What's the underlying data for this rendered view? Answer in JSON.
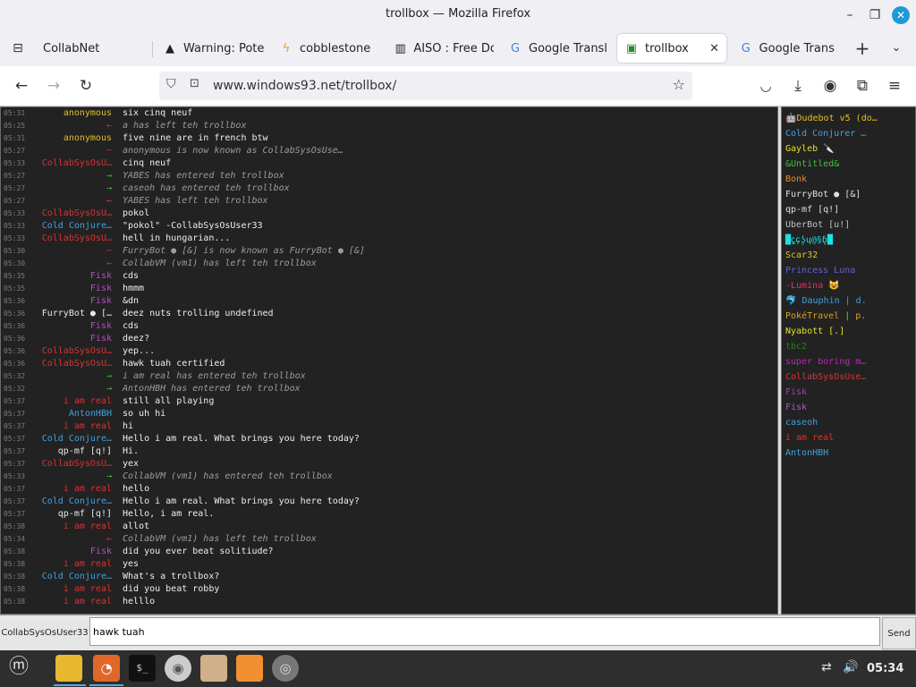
{
  "window": {
    "title": "trollbox — Mozilla Firefox"
  },
  "tabs": [
    {
      "label": "CollabNet",
      "icon": "tab-list-icon"
    },
    {
      "label": "Warning: Pote",
      "icon": "warning-icon"
    },
    {
      "label": "cobblestone",
      "icon": "bolt-icon"
    },
    {
      "label": "AISO : Free Do",
      "icon": "bank-icon"
    },
    {
      "label": "Google Transl",
      "icon": "translate-icon"
    },
    {
      "label": "trollbox",
      "icon": "trollbox-icon",
      "active": true
    },
    {
      "label": "Google Transl",
      "icon": "translate-icon"
    }
  ],
  "nav": {
    "url": "www.windows93.net/trollbox/"
  },
  "messages": [
    {
      "time": "05:31",
      "nick": "anonymous",
      "color": "#e0c020",
      "text": "six cinq neuf",
      "sys": false
    },
    {
      "time": "05:25",
      "nick": "←",
      "color": "#e03030",
      "text": "a has left teh trollbox",
      "sys": true
    },
    {
      "time": "05:31",
      "nick": "anonymous",
      "color": "#e0c020",
      "text": "five nine are in french btw",
      "sys": false
    },
    {
      "time": "05:27",
      "nick": "~",
      "color": "#e03030",
      "text": "anonymous is now known as CollabSysOsUse…",
      "sys": true
    },
    {
      "time": "05:33",
      "nick": "CollabSysOsU…",
      "color": "#e03030",
      "text": "cinq neuf",
      "sys": false
    },
    {
      "time": "05:27",
      "nick": "→",
      "color": "#40c040",
      "text": "YABES has entered teh trollbox",
      "sys": true
    },
    {
      "time": "05:27",
      "nick": "→",
      "color": "#40c040",
      "text": "caseoh has entered teh trollbox",
      "sys": true
    },
    {
      "time": "05:27",
      "nick": "←",
      "color": "#e03030",
      "text": "YABES has left teh trollbox",
      "sys": true
    },
    {
      "time": "05:33",
      "nick": "CollabSysOsU…",
      "color": "#e03030",
      "text": "pokol",
      "sys": false
    },
    {
      "time": "05:33",
      "nick": "Cold Conjure…",
      "color": "#40a0e0",
      "text": "\"pokol\" -CollabSysOsUser33",
      "sys": false
    },
    {
      "time": "05:33",
      "nick": "CollabSysOsU…",
      "color": "#e03030",
      "text": "hell in hungarian...",
      "sys": false
    },
    {
      "time": "05:30",
      "nick": "~",
      "color": "#e03030",
      "text": "FurryBot ● [&] is now known as FurryBot ● [&]",
      "sys": true
    },
    {
      "time": "05:30",
      "nick": "←",
      "color": "#e03030",
      "text": "CollabVM (vm1) has left teh trollbox",
      "sys": true
    },
    {
      "time": "05:35",
      "nick": "Fisk",
      "color": "#b050c0",
      "text": "cds",
      "sys": false
    },
    {
      "time": "05:35",
      "nick": "Fisk",
      "color": "#b050c0",
      "text": "hmmm",
      "sys": false
    },
    {
      "time": "05:36",
      "nick": "Fisk",
      "color": "#b050c0",
      "text": "&dn",
      "sys": false
    },
    {
      "time": "05:36",
      "nick": "FurryBot ● […",
      "color": "#e8e8e8",
      "text": "deez nuts trolling undefined",
      "sys": false
    },
    {
      "time": "05:36",
      "nick": "Fisk",
      "color": "#b050c0",
      "text": "cds",
      "sys": false
    },
    {
      "time": "05:36",
      "nick": "Fisk",
      "color": "#b050c0",
      "text": "deez?",
      "sys": false
    },
    {
      "time": "05:36",
      "nick": "CollabSysOsU…",
      "color": "#e03030",
      "text": "yep...",
      "sys": false
    },
    {
      "time": "05:36",
      "nick": "CollabSysOsU…",
      "color": "#e03030",
      "text": "hawk tuah certified",
      "sys": false
    },
    {
      "time": "05:32",
      "nick": "→",
      "color": "#40c040",
      "text": "i am real has entered teh trollbox",
      "sys": true
    },
    {
      "time": "05:32",
      "nick": "→",
      "color": "#40c040",
      "text": "AntonHBH has entered teh trollbox",
      "sys": true
    },
    {
      "time": "05:37",
      "nick": "i am real",
      "color": "#e03030",
      "text": "still all playing",
      "sys": false
    },
    {
      "time": "05:37",
      "nick": "AntonHBH",
      "color": "#40a0e0",
      "text": "so uh hi",
      "sys": false
    },
    {
      "time": "05:37",
      "nick": "i am real",
      "color": "#e03030",
      "text": "hi",
      "sys": false
    },
    {
      "time": "05:37",
      "nick": "Cold Conjure…",
      "color": "#40a0e0",
      "text": "Hello i am real. What brings you here today?",
      "sys": false
    },
    {
      "time": "05:37",
      "nick": "qp-mf [q!]",
      "color": "#e8e8e8",
      "text": "Hi.",
      "sys": false
    },
    {
      "time": "05:37",
      "nick": "CollabSysOsU…",
      "color": "#e03030",
      "text": "yex",
      "sys": false
    },
    {
      "time": "05:33",
      "nick": "→",
      "color": "#40c040",
      "text": "CollabVM (vm1) has entered teh trollbox",
      "sys": true
    },
    {
      "time": "05:37",
      "nick": "i am real",
      "color": "#e03030",
      "text": "hello",
      "sys": false
    },
    {
      "time": "05:37",
      "nick": "Cold Conjure…",
      "color": "#40a0e0",
      "text": "Hello i am real. What brings you here today?",
      "sys": false
    },
    {
      "time": "05:37",
      "nick": "qp-mf [q!]",
      "color": "#e8e8e8",
      "text": "Hello, i am real.",
      "sys": false
    },
    {
      "time": "05:38",
      "nick": "i am real",
      "color": "#e03030",
      "text": "allot",
      "sys": false
    },
    {
      "time": "05:34",
      "nick": "←",
      "color": "#e03030",
      "text": "CollabVM (vm1) has left teh trollbox",
      "sys": true
    },
    {
      "time": "05:38",
      "nick": "Fisk",
      "color": "#b050c0",
      "text": "did you ever beat solitiude?",
      "sys": false
    },
    {
      "time": "05:38",
      "nick": "i am real",
      "color": "#e03030",
      "text": "yes",
      "sys": false
    },
    {
      "time": "05:38",
      "nick": "Cold Conjure…",
      "color": "#40a0e0",
      "text": "What's a trollbox?",
      "sys": false
    },
    {
      "time": "05:38",
      "nick": "i am real",
      "color": "#e03030",
      "text": "did you beat robby",
      "sys": false
    },
    {
      "time": "05:38",
      "nick": "i am real",
      "color": "#e03030",
      "text": "helllo",
      "sys": false
    }
  ],
  "users": [
    {
      "name": "🤖Dudebot v5 (do…",
      "color": "#e8c020"
    },
    {
      "name": "Cold Conjurer …",
      "color": "#40a0e0"
    },
    {
      "name": "Gayleb 🔪",
      "color": "#e8e020"
    },
    {
      "name": "&Untitled&",
      "color": "#40c040"
    },
    {
      "name": "Bonk",
      "color": "#e09020"
    },
    {
      "name": "FurryBot ● [&]",
      "color": "#e0e0e0"
    },
    {
      "name": "qp-mf [q!]",
      "color": "#e0e0e0"
    },
    {
      "name": "UberBot [u!]",
      "color": "#c0c0c0"
    },
    {
      "name": "█ꞔ̯ɕ̣ʖ̥ɥ@§ɓ̥█",
      "color": "#20e0e0"
    },
    {
      "name": "Scar32",
      "color": "#e8c020"
    },
    {
      "name": "Princess Luna",
      "color": "#6060e0"
    },
    {
      "name": "-Lumina 😺",
      "color": "#e03070"
    },
    {
      "name": "🐬 Dauphin | d.",
      "color": "#40a0e0"
    },
    {
      "name": "PokéTravel | p.",
      "color": "#e0a020"
    },
    {
      "name": "Nyabott [.]",
      "color": "#e8e020"
    },
    {
      "name": "tbc2",
      "color": "#208020"
    },
    {
      "name": "super boring m…",
      "color": "#c020c0"
    },
    {
      "name": "CollabSysOsUse…",
      "color": "#e03030"
    },
    {
      "name": "Fisk",
      "color": "#a040b0"
    },
    {
      "name": "Fisk",
      "color": "#a060c0"
    },
    {
      "name": "caseoh",
      "color": "#40a0e0"
    },
    {
      "name": "i am real",
      "color": "#e03030"
    },
    {
      "name": "AntonHBH",
      "color": "#40a0e0"
    }
  ],
  "input": {
    "nick": "CollabSysOsUser33",
    "value": "hawk tuah",
    "send": "Send"
  },
  "taskbar": {
    "clock": "05:34"
  }
}
